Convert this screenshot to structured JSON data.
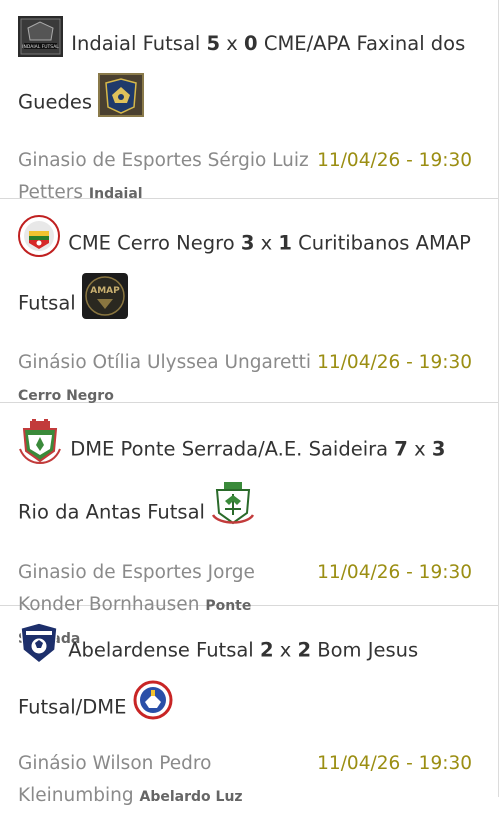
{
  "matches": [
    {
      "home": "Indaial Futsal",
      "home_score": "5",
      "separator": "x",
      "away_score": "0",
      "away": "CME/APA Faxinal dos Guedes",
      "home_logo_text": "INDAIAL FUTSAL",
      "venue": "Ginasio de Esportes Sérgio Luiz Petters",
      "city": "Indaial",
      "datetime": "11/04/26 - 19:30"
    },
    {
      "home": "CME Cerro Negro",
      "home_score": "3",
      "separator": "x",
      "away_score": "1",
      "away": "Curitibanos AMAP Futsal",
      "away_logo_text": "AMAP",
      "venue": "Ginásio Otília Ulyssea Ungaretti",
      "city": "Cerro Negro",
      "datetime": "11/04/26 - 19:30"
    },
    {
      "home": "DME Ponte Serrada/A.E. Saideira",
      "home_score": "7",
      "separator": "x",
      "away_score": "3",
      "away": "Rio da Antas Futsal",
      "venue": "Ginasio de Esportes Jorge Konder Bornhausen",
      "city": "Ponte Serrada",
      "datetime": "11/04/26 - 19:30"
    },
    {
      "home": "Abelardense Futsal",
      "home_score": "2",
      "separator": "x",
      "away_score": "2",
      "away": "Bom Jesus Futsal/DME",
      "venue": "Ginásio Wilson Pedro Kleinumbing",
      "city": "Abelardo Luz",
      "datetime": "11/04/26 - 19:30"
    }
  ],
  "colors": {
    "date": "#9b8e13",
    "venue": "#8a8a8a",
    "divider": "#d9d9d9"
  }
}
